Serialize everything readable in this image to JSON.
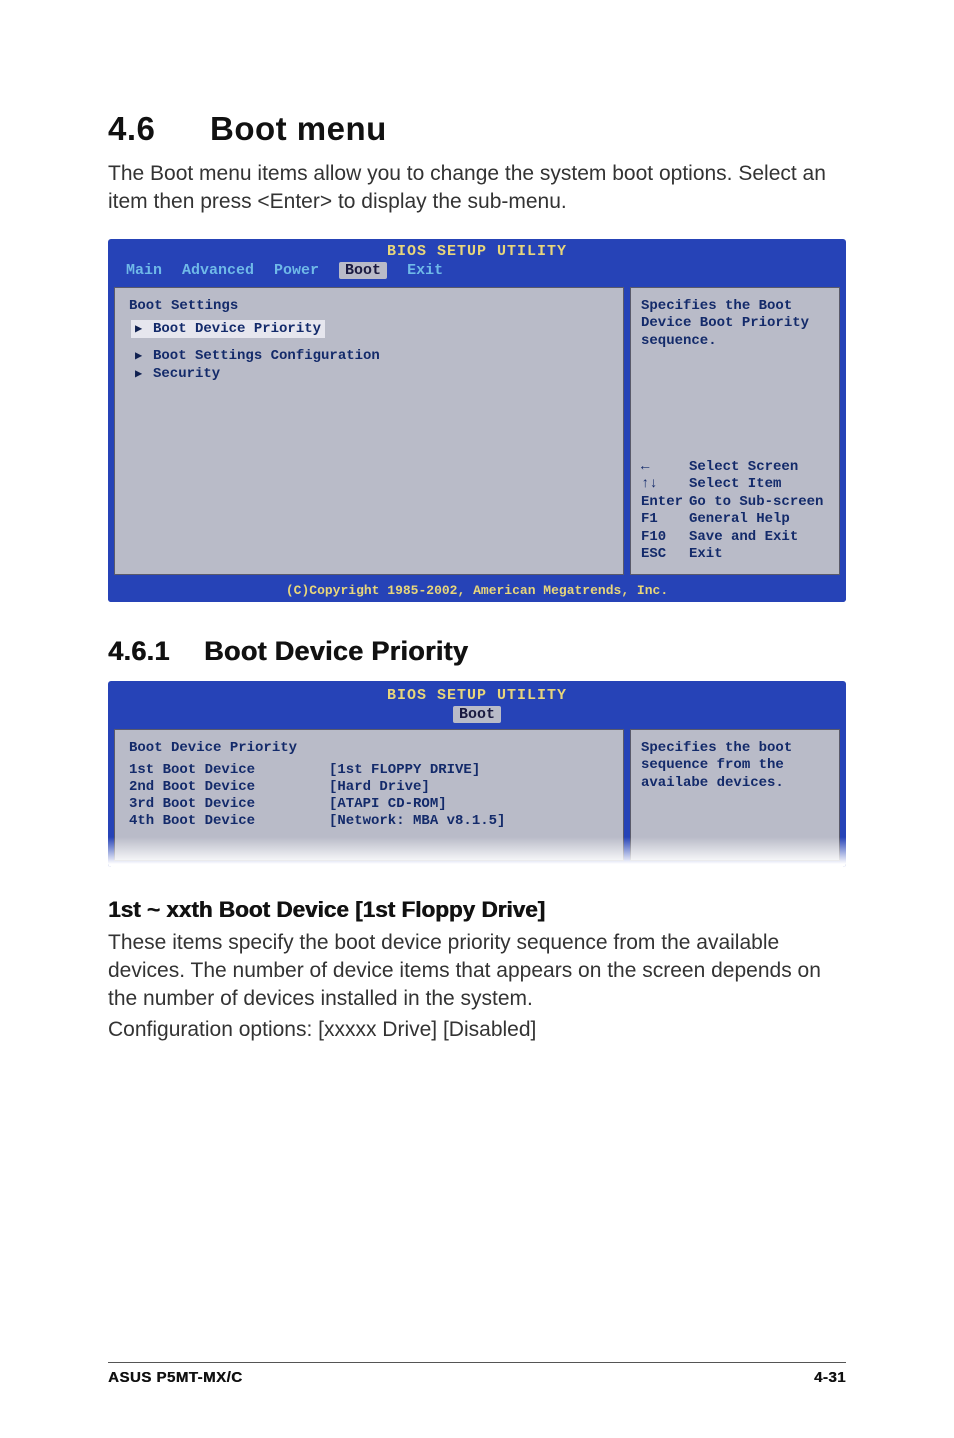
{
  "heading": {
    "num": "4.6",
    "title": "Boot menu"
  },
  "intro": "The Boot menu items allow you to change the system boot options. Select an item then press <Enter> to display the sub-menu.",
  "bios1": {
    "utility_title": "BIOS SETUP UTILITY",
    "tabs": {
      "main": "Main",
      "advanced": "Advanced",
      "power": "Power",
      "boot": "Boot",
      "exit": "Exit"
    },
    "section_title": "Boot Settings",
    "items": {
      "bdp": "Boot Device Priority",
      "bsc": "Boot Settings Configuration",
      "sec": "Security"
    },
    "help_top": "Specifies the Boot Device Boot Priority sequence.",
    "keys": {
      "lr": "Select Screen",
      "ud": "Select Item",
      "enter_k": "Enter",
      "enter": "Go to Sub-screen",
      "f1_k": "F1",
      "f1": "General Help",
      "f10_k": "F10",
      "f10": "Save and Exit",
      "esc_k": "ESC",
      "esc": "Exit"
    },
    "copyright": "(C)Copyright 1985-2002, American Megatrends, Inc."
  },
  "sub1": {
    "num": "4.6.1",
    "title": "Boot Device Priority"
  },
  "bios2": {
    "utility_title": "BIOS SETUP UTILITY",
    "tab_boot": "Boot",
    "section_title": "Boot Device Priority",
    "rows": {
      "r1l": "1st Boot Device",
      "r1v": "[1st FLOPPY DRIVE]",
      "r2l": "2nd Boot Device",
      "r2v": "[Hard Drive]",
      "r3l": "3rd Boot Device",
      "r3v": "[ATAPI CD-ROM]",
      "r4l": "4th Boot Device",
      "r4v": "[Network: MBA v8.1.5]"
    },
    "help": "Specifies the boot sequence from the availabe devices."
  },
  "sub2": {
    "title": "1st ~ xxth Boot Device [1st Floppy Drive]"
  },
  "para2a": "These items specify the boot device priority sequence from the available devices. The number of device items that appears on the screen depends on the number of devices installed in the system.",
  "para2b": "Configuration options: [xxxxx Drive] [Disabled]",
  "footer": {
    "left": "ASUS P5MT-MX/C",
    "right": "4-31"
  }
}
